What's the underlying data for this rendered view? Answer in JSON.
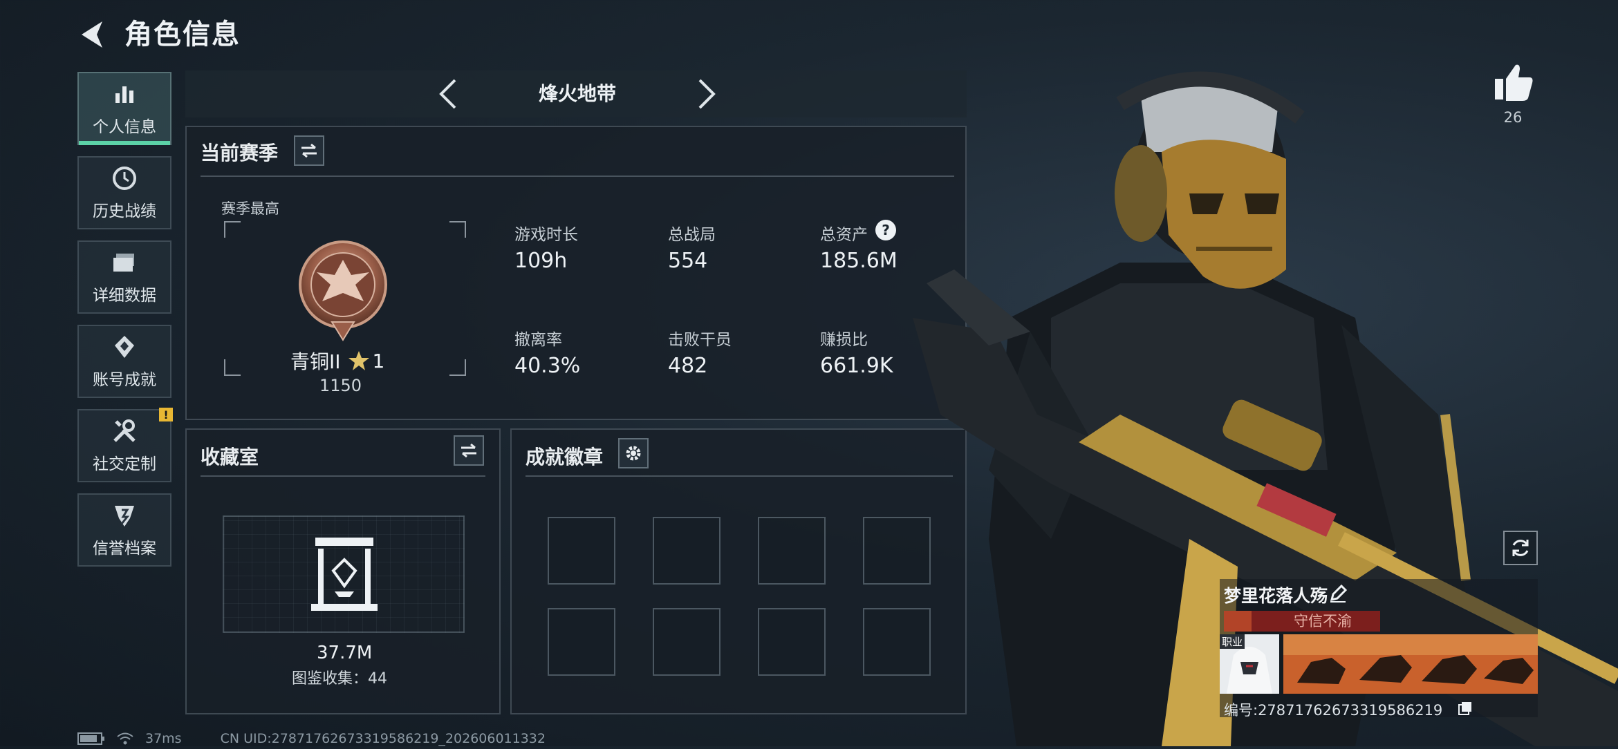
{
  "header": {
    "title": "角色信息"
  },
  "sidebar": {
    "items": [
      {
        "label": "个人信息",
        "icon": "bar-chart-icon",
        "active": true
      },
      {
        "label": "历史战绩",
        "icon": "clock-icon",
        "active": false
      },
      {
        "label": "详细数据",
        "icon": "folder-icon",
        "active": false
      },
      {
        "label": "账号成就",
        "icon": "achievement-icon",
        "active": false
      },
      {
        "label": "社交定制",
        "icon": "tools-icon",
        "active": false,
        "alert": "!"
      },
      {
        "label": "信誉档案",
        "icon": "shield-icon",
        "active": false
      }
    ]
  },
  "mode_nav": {
    "title": "烽火地带"
  },
  "season": {
    "title": "当前赛季",
    "best_label": "赛季最高",
    "rank_name": "青铜II",
    "rank_stars": "1",
    "rank_score": "1150",
    "stats": [
      {
        "label": "游戏时长",
        "value": "109h"
      },
      {
        "label": "总战局",
        "value": "554"
      },
      {
        "label": "总资产",
        "value": "185.6M",
        "help": "?"
      },
      {
        "label": "撤离率",
        "value": "40.3%"
      },
      {
        "label": "击败干员",
        "value": "482"
      },
      {
        "label": "赚损比",
        "value": "661.9K"
      }
    ]
  },
  "collection": {
    "title": "收藏室",
    "value": "37.7M",
    "codex": "图鉴收集：44"
  },
  "badges": {
    "title": "成就徽章",
    "slots": 8
  },
  "right": {
    "like_count": "26",
    "player_name": "梦里花落人殇",
    "player_tag": "守信不渝",
    "job_label": "职业",
    "uid_line": "编号:2787176267331958621​9"
  },
  "footer": {
    "ping": "37ms",
    "uid": "CN UID:2787176267331958621​9_202606011332"
  },
  "colors": {
    "accent": "#5cd2a7",
    "alert": "#e8b733",
    "tag_bar": "#7c1f1d"
  }
}
